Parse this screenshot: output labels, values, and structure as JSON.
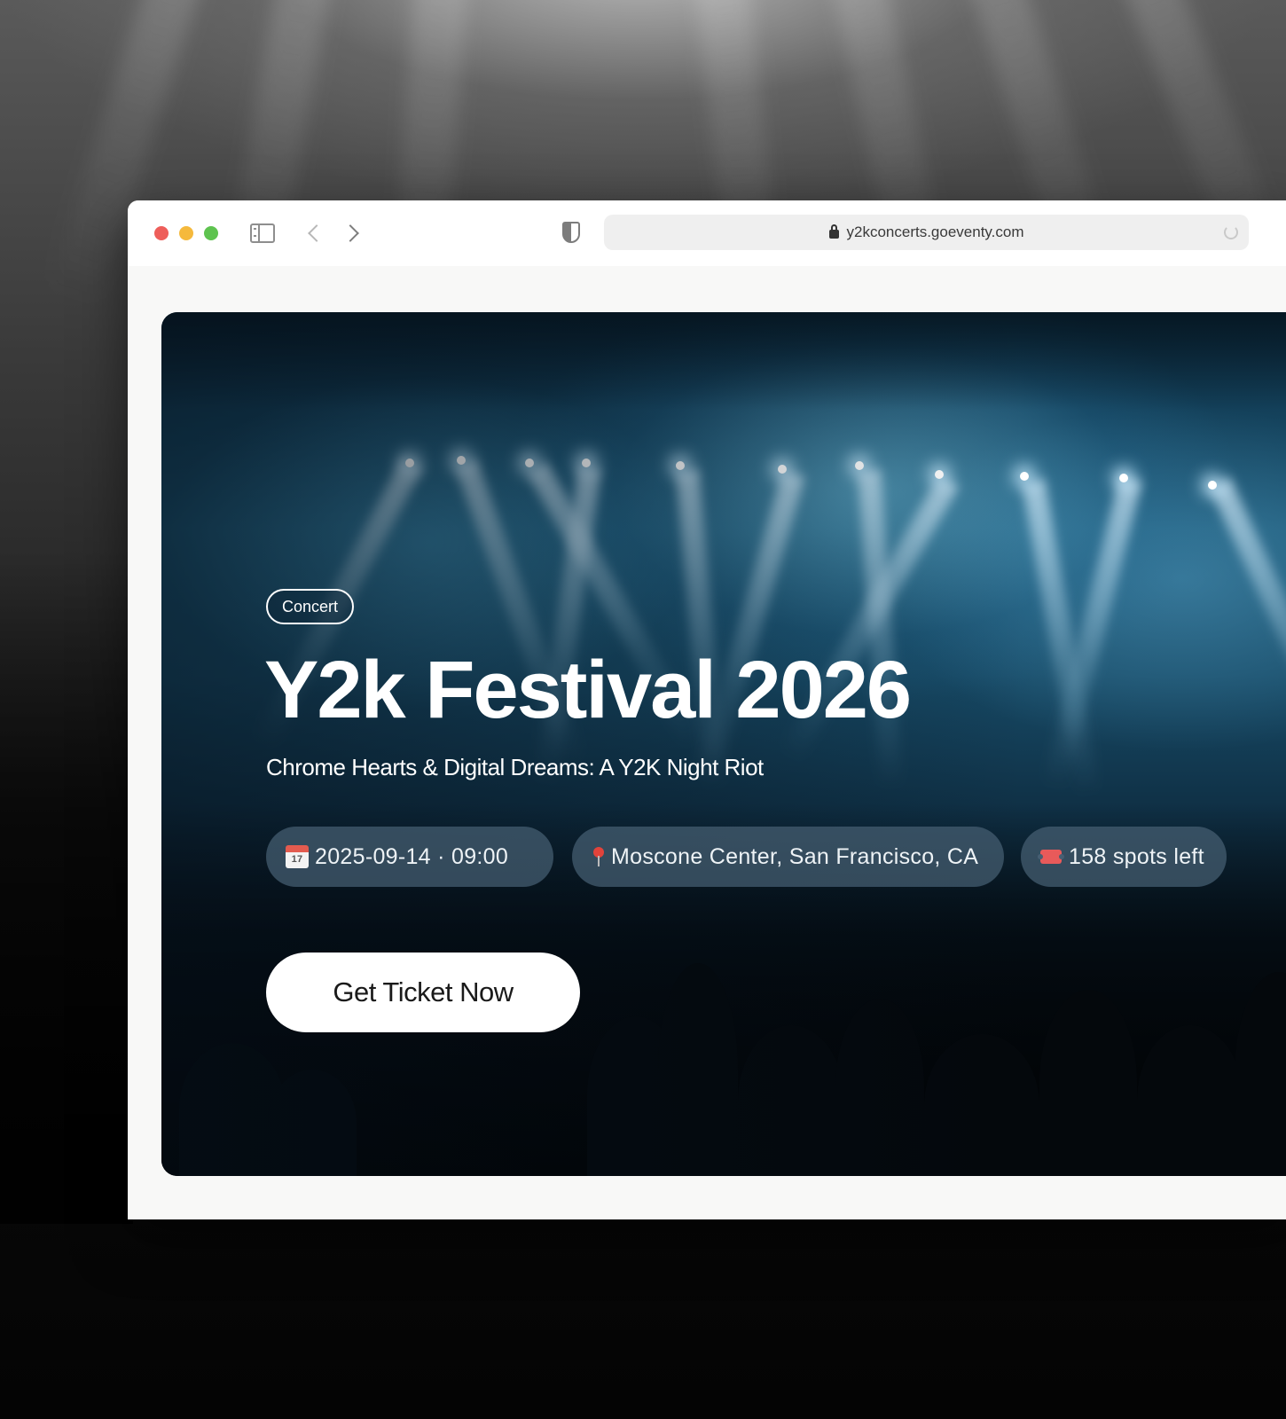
{
  "browser": {
    "url": "y2kconcerts.goeventy.com"
  },
  "event": {
    "category": "Concert",
    "title": "Y2k Festival 2026",
    "subtitle": "Chrome Hearts & Digital Dreams: A Y2K Night Riot",
    "datetime": "2025-09-14 · 09:00",
    "location": "Moscone Center, San Francisco, CA",
    "spots_left": "158 spots left",
    "cta_label": "Get Ticket Now"
  },
  "icons": {
    "date": "calendar-icon",
    "location": "map-pin-icon",
    "spots": "ticket-icon"
  },
  "colors": {
    "traffic_red": "#ee5e5a",
    "traffic_yellow": "#f5b93c",
    "traffic_green": "#5ec34f",
    "hero_blue": "#1b5573",
    "chip_bg": "#46607380",
    "cta_bg": "#ffffff"
  }
}
